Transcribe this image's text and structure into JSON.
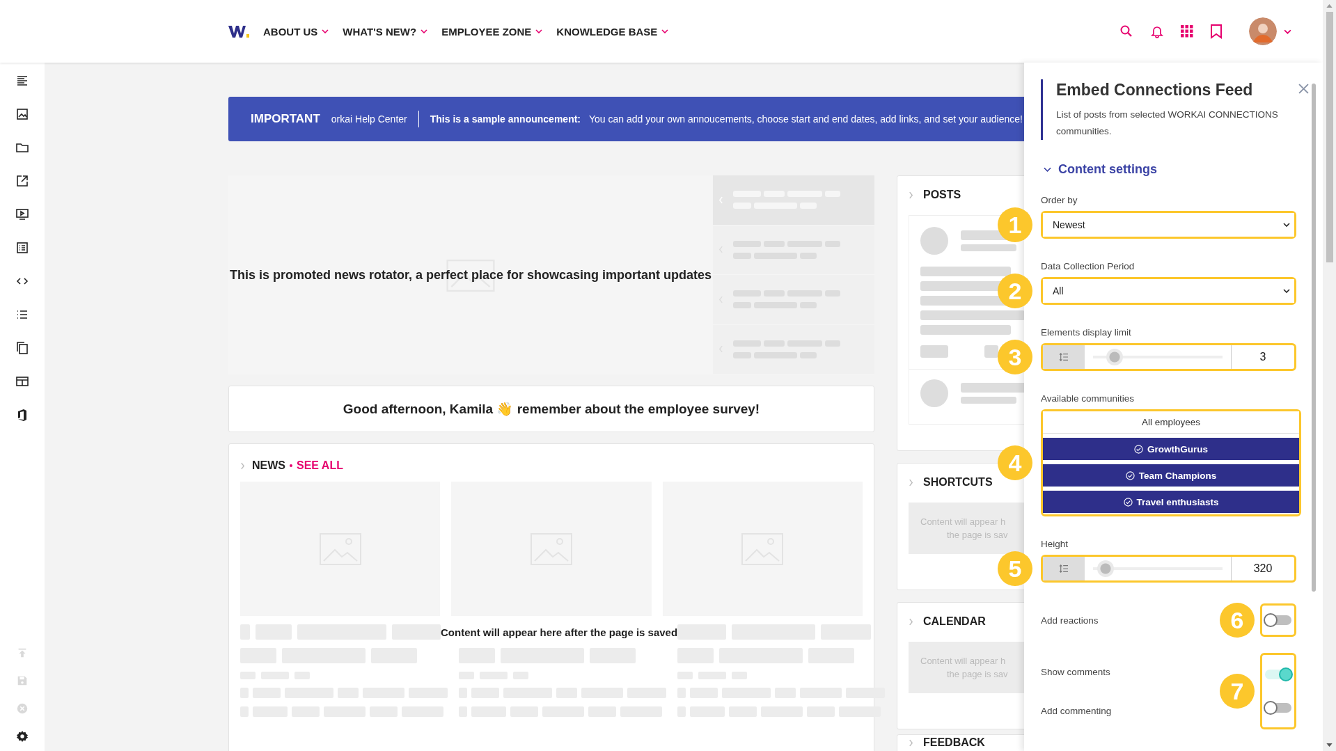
{
  "nav": {
    "menu": [
      {
        "label": "ABOUT US"
      },
      {
        "label": "WHAT'S NEW?"
      },
      {
        "label": "EMPLOYEE ZONE"
      },
      {
        "label": "KNOWLEDGE BASE"
      }
    ]
  },
  "sidebar": {
    "tools": [
      {
        "kind": "text"
      },
      {
        "kind": "image"
      },
      {
        "kind": "folder"
      },
      {
        "kind": "external"
      },
      {
        "kind": "video"
      },
      {
        "kind": "listbox"
      },
      {
        "kind": "code"
      },
      {
        "kind": "list"
      },
      {
        "kind": "copy"
      },
      {
        "kind": "layout"
      },
      {
        "kind": "office"
      }
    ],
    "bottom_tools": [
      {
        "kind": "upload",
        "disabled": true
      },
      {
        "kind": "save",
        "disabled": true
      },
      {
        "kind": "remove",
        "disabled": true
      },
      {
        "kind": "settings",
        "disabled": false
      }
    ]
  },
  "announcement": {
    "label": "IMPORTANT",
    "ticker": "orkai Help Center",
    "title": "This is a sample announcement:",
    "text": "You can add your own annoucements, choose start and end dates, add links, and set your audience!"
  },
  "rotator": {
    "text": "This is promoted news rotator, a perfect place for showcasing important updates"
  },
  "greeting": {
    "text": "Good afternoon, Kamila 👋 remember about the employee survey!"
  },
  "news": {
    "title": "NEWS",
    "link": "SEE ALL",
    "placeholder": "Content will appear here after the page is saved"
  },
  "widgets": [
    {
      "title": "POSTS",
      "kind": "posts"
    },
    {
      "title": "SHORTCUTS",
      "kind": "placeholder",
      "lines": [
        "Content will appear h",
        "the page is sav"
      ]
    },
    {
      "title": "CALENDAR",
      "kind": "placeholder",
      "lines": [
        "Content will appear h",
        "the page is sav"
      ]
    },
    {
      "title": "FEEDBACK",
      "kind": "cut"
    }
  ],
  "panel": {
    "title": "Embed Connections Feed",
    "description": "List of posts from selected WORKAI CONNECTIONS communities.",
    "section": {
      "title": "Content settings",
      "expanded": true
    },
    "fields": [
      {
        "kind": "select",
        "label": "Order by",
        "value": "Newest",
        "marker": "1"
      },
      {
        "kind": "select",
        "label": "Data Collection Period",
        "value": "All",
        "marker": "2"
      },
      {
        "kind": "slider",
        "label": "Elements display limit",
        "value": "3",
        "level": 0.1,
        "marker": "3"
      },
      {
        "kind": "communities",
        "label": "Available communities",
        "marker": "4",
        "items": [
          {
            "label": "All employees",
            "selected": false
          },
          {
            "label": "GrowthGurus",
            "selected": true
          },
          {
            "label": "Team Champions",
            "selected": true
          },
          {
            "label": "Travel enthusiasts",
            "selected": true
          }
        ]
      },
      {
        "kind": "slider",
        "label": "Height",
        "value": "320",
        "level": 0.03,
        "marker": "5"
      },
      {
        "kind": "toggles",
        "marker": "6",
        "items": [
          {
            "label": "Add reactions",
            "on": false
          }
        ]
      },
      {
        "kind": "toggles",
        "marker": "7",
        "items": [
          {
            "label": "Show comments",
            "on": true
          },
          {
            "label": "Add commenting",
            "on": false
          }
        ]
      }
    ]
  }
}
